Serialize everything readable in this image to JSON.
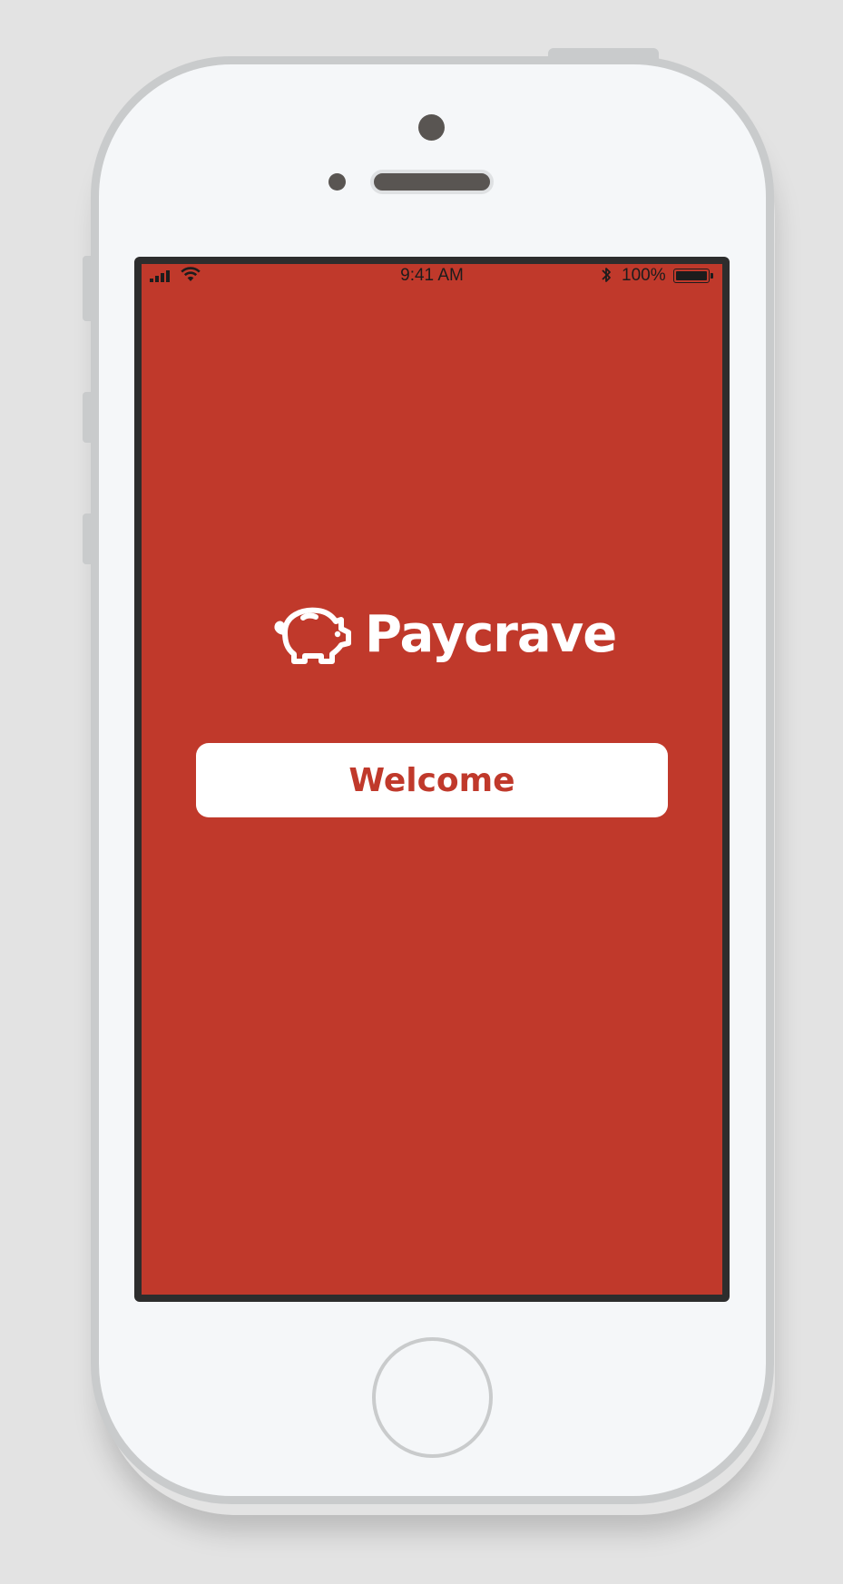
{
  "status_bar": {
    "time": "9:41 AM",
    "battery_percent": "100%",
    "signal_bars": 4,
    "wifi_icon": "wifi-icon",
    "bluetooth_icon": "bluetooth-icon"
  },
  "logo": {
    "icon": "piggy-bank-icon",
    "text": "Paycrave"
  },
  "welcome_button": {
    "label": "Welcome"
  },
  "colors": {
    "background": "#c0392b",
    "button_bg": "#ffffff",
    "button_text": "#c0392b"
  }
}
